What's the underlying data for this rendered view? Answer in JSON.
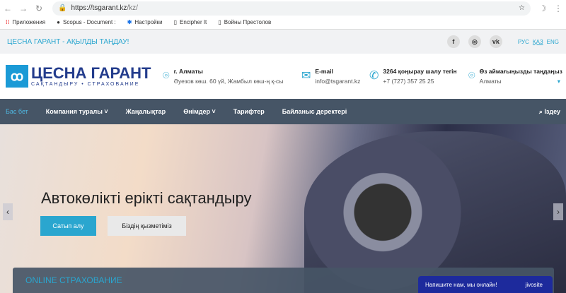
{
  "browser": {
    "url_main": "https://tsgarant.kz",
    "url_tail": "/kz/",
    "bookmarks": [
      "Приложения",
      "Scopus - Document :",
      "Настройки",
      "Encipher It",
      "Войны Престолов"
    ]
  },
  "topbar": {
    "slogan": "ЦЕСНА ГАРАНТ - АҚЫЛДЫ ТАҢДАУ!",
    "social": [
      "f",
      "◎",
      "vk"
    ],
    "langs": [
      "РУС",
      "ҚАЗ",
      "ENG"
    ]
  },
  "logo": {
    "title": "ЦЕСНА ГАРАНТ",
    "subtitle": "САҚТАНДЫРУ • СТРАХОВАНИЕ"
  },
  "contacts": [
    {
      "title": "г. Алматы",
      "sub": "Әуезов көш. 60 үй, Жамбыл көш-ң қ-сы"
    },
    {
      "title": "E-mail",
      "sub": "info@tsgarant.kz"
    },
    {
      "title": "3264 қоңырау шалу тегін",
      "sub": "+7 (727) 357 25 25"
    },
    {
      "title": "Өз аймағыңызды таңдаңыз",
      "sub": "Алматы"
    }
  ],
  "menu": {
    "items": [
      "Бас бет",
      "Компания туралы ˅",
      "Жаңалықтар",
      "Өнімдер ˅",
      "Тарифтер",
      "Байланыс деректері"
    ],
    "search": "Іздеу"
  },
  "hero": {
    "title": "Автокөлікті ерікті сақтандыру",
    "buy": "Сатып алу",
    "services": "Біздің қызметіміз"
  },
  "online": {
    "title": "ONLINE СТРАХОВАНИЕ"
  },
  "chat": {
    "text": "Напишите нам, мы онлайн!",
    "brand": "jivosite"
  }
}
